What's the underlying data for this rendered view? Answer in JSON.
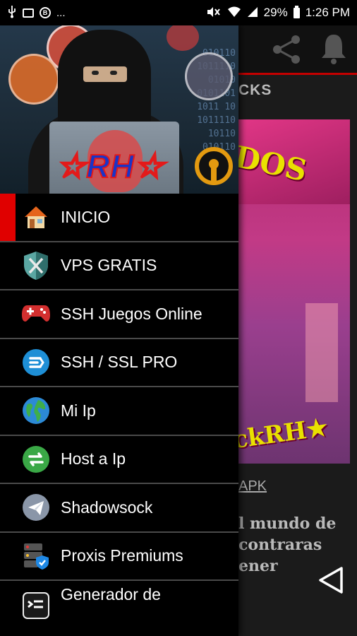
{
  "status_bar": {
    "battery_percent": "29%",
    "time": "1:26 PM",
    "left_icons": [
      "usb-icon",
      "image-icon",
      "b-app-icon",
      "more-notifications-icon"
    ],
    "right_icons": [
      "mute-icon",
      "wifi-icon",
      "signal-icon",
      "battery-icon"
    ],
    "more": "..."
  },
  "background": {
    "heading_fragment": "CKS",
    "poster_text_top": "DOS",
    "poster_text_bottom": "ckRH★",
    "link_fragment": "APK",
    "description_lines": [
      "l mundo de",
      "contraras",
      "ener"
    ]
  },
  "drawer": {
    "header": {
      "logo_text": "☆RH☆",
      "code_lines": [
        "010110",
        "1011110",
        "01010",
        "0101101",
        "1011 10",
        "1011110",
        "10110",
        "010110"
      ]
    },
    "items": [
      {
        "label": "INICIO",
        "icon": "home-icon",
        "active": true
      },
      {
        "label": "VPS GRATIS",
        "icon": "shield-tools-icon",
        "active": false
      },
      {
        "label": "SSH Juegos Online",
        "icon": "gamepad-icon",
        "active": false
      },
      {
        "label": "SSH / SSL PRO",
        "icon": "ssh-circle-icon",
        "active": false
      },
      {
        "label": "Mi Ip",
        "icon": "globe-icon",
        "active": false
      },
      {
        "label": "Host a Ip",
        "icon": "swap-arrows-icon",
        "active": false
      },
      {
        "label": "Shadowsock",
        "icon": "paper-plane-icon",
        "active": false
      },
      {
        "label": "Proxis Premiums",
        "icon": "server-shield-icon",
        "active": false
      },
      {
        "label": "Generador de",
        "icon": "generator-icon",
        "active": false
      }
    ]
  },
  "colors": {
    "accent_red": "#e00000",
    "appbar_underline": "#c40000",
    "poster_pink": "#c23a86",
    "poster_yellow": "#e9e100"
  }
}
